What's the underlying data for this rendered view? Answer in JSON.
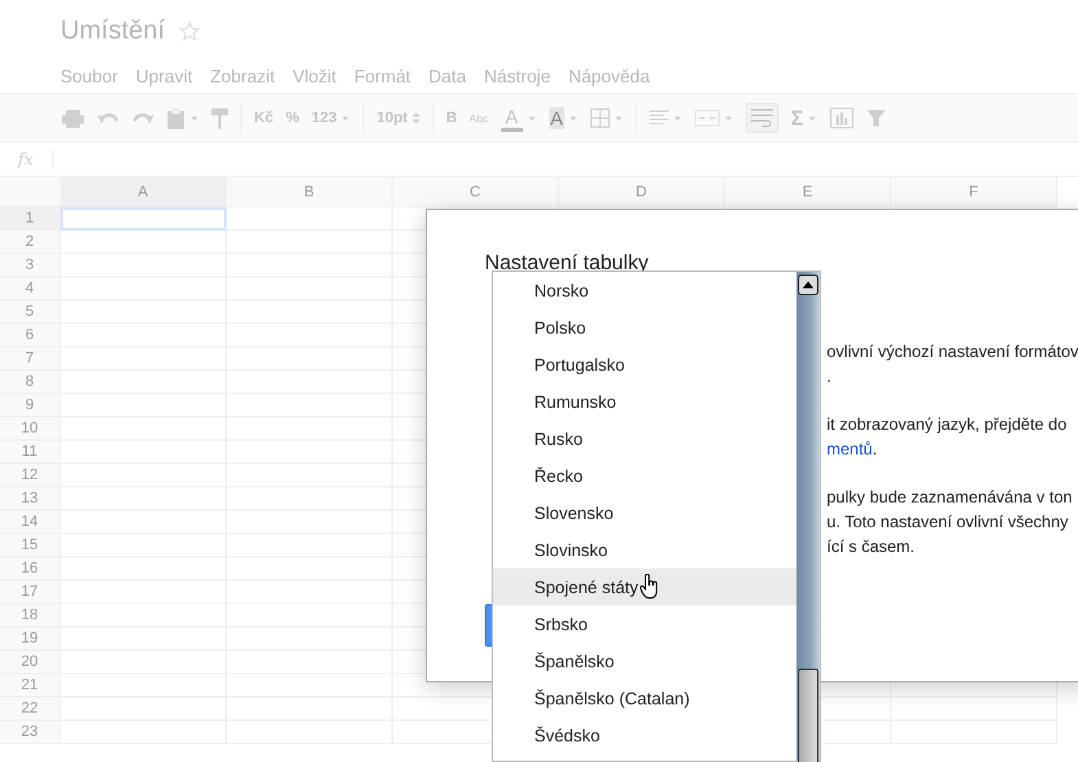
{
  "document": {
    "title": "Umístění",
    "starred": false
  },
  "menu": [
    "Soubor",
    "Upravit",
    "Zobrazit",
    "Vložit",
    "Formát",
    "Data",
    "Nástroje",
    "Nápověda"
  ],
  "toolbar": {
    "currency": "Kč",
    "percent": "%",
    "number_format": "123",
    "font_size": "10pt",
    "bold": "B",
    "strikethrough": "Abc",
    "text_color": "A",
    "fill_color": "A",
    "functions": "Σ",
    "wrap_on": true
  },
  "formula_bar": {
    "label": "fx"
  },
  "grid": {
    "columns": [
      "A",
      "B",
      "C",
      "D",
      "E",
      "F"
    ],
    "rows": [
      "1",
      "2",
      "3",
      "4",
      "5",
      "6",
      "7",
      "8",
      "9",
      "10",
      "11",
      "12",
      "13",
      "14",
      "15",
      "16",
      "17",
      "18",
      "19",
      "20",
      "21",
      "22",
      "23"
    ]
  },
  "dialog": {
    "title": "Nastavení tabulky",
    "lines": [
      {
        "text": "ovlivní výchozí nastavení formátov",
        "kind": "text"
      },
      {
        "text": ".",
        "kind": "text"
      },
      {
        "text": "it zobrazovaný jazyk, přejděte do",
        "kind": "gap"
      },
      {
        "text": "mentů",
        "kind": "link",
        "after": "."
      },
      {
        "text": "pulky bude zaznamenávána v ton",
        "kind": "gap"
      },
      {
        "text": "u. Toto nastavení ovlivní všechny",
        "kind": "text"
      },
      {
        "text": "ící s časem.",
        "kind": "text"
      }
    ]
  },
  "dropdown": {
    "items": [
      {
        "label": "Norsko",
        "highlighted": false
      },
      {
        "label": "Polsko",
        "highlighted": false
      },
      {
        "label": "Portugalsko",
        "highlighted": false
      },
      {
        "label": "Rumunsko",
        "highlighted": false
      },
      {
        "label": "Rusko",
        "highlighted": false
      },
      {
        "label": "Řecko",
        "highlighted": false
      },
      {
        "label": "Slovensko",
        "highlighted": false
      },
      {
        "label": "Slovinsko",
        "highlighted": false
      },
      {
        "label": "Spojené státy",
        "highlighted": true
      },
      {
        "label": "Srbsko",
        "highlighted": false
      },
      {
        "label": "Španělsko",
        "highlighted": false
      },
      {
        "label": "Španělsko (Catalan)",
        "highlighted": false
      },
      {
        "label": "Švédsko",
        "highlighted": false
      }
    ]
  }
}
